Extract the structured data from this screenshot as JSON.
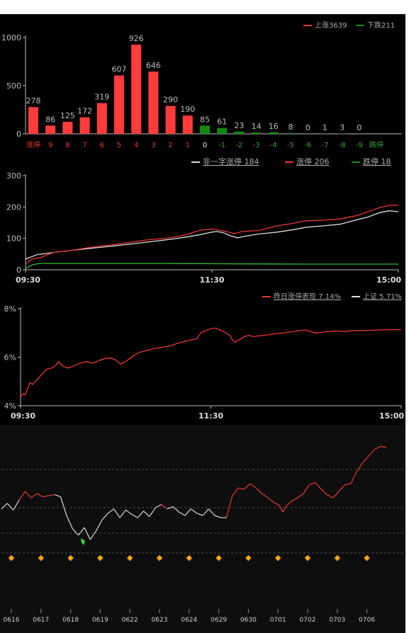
{
  "colors": {
    "red": "#e8382f",
    "bar_red": "#ff3b3b",
    "green": "#138a13",
    "white": "#dddddd",
    "axis": "#bbbbbb",
    "diamond": "#f5a70e",
    "highlight": "#3cdc3c"
  },
  "chart_data": [
    {
      "type": "bar",
      "legend": [
        {
          "name": "上涨3639",
          "color": "#e8382f"
        },
        {
          "name": "下跌211",
          "color": "#138a13"
        }
      ],
      "categories": [
        "涨停",
        "9",
        "8",
        "7",
        "6",
        "5",
        "4",
        "3",
        "2",
        "1",
        "0",
        "-1",
        "-2",
        "-3",
        "-4",
        "-5",
        "-6",
        "-7",
        "-8",
        "-9",
        "跌停"
      ],
      "values": [
        278,
        86,
        125,
        172,
        319,
        607,
        926,
        646,
        290,
        190,
        85,
        61,
        23,
        14,
        16,
        8,
        0,
        1,
        3,
        0
      ],
      "yticks": [
        "0",
        "500",
        "1000"
      ],
      "ylim": [
        0,
        1000
      ]
    },
    {
      "type": "line",
      "legend": [
        {
          "name": "非一字涨停 184",
          "color": "#dddddd"
        },
        {
          "name": "涨停 206",
          "color": "#e8382f"
        },
        {
          "name": "跌停 18",
          "color": "#138a13"
        }
      ],
      "xticks": [
        "09:30",
        "11:30",
        "15:00"
      ],
      "yticks": [
        "0",
        "100",
        "200",
        "300"
      ],
      "ylim": [
        0,
        300
      ],
      "series": [
        {
          "values": [
            [
              0,
              34
            ],
            [
              5,
              48
            ],
            [
              12,
              55
            ],
            [
              20,
              62
            ],
            [
              30,
              70
            ],
            [
              38,
              76
            ],
            [
              45,
              82
            ],
            [
              52,
              88
            ],
            [
              60,
              95
            ],
            [
              68,
              103
            ],
            [
              75,
              112
            ],
            [
              80,
              120
            ],
            [
              82,
              122
            ],
            [
              85,
              118
            ],
            [
              88,
              108
            ],
            [
              91,
              102
            ],
            [
              95,
              108
            ],
            [
              100,
              114
            ],
            [
              108,
              120
            ],
            [
              115,
              128
            ],
            [
              120,
              135
            ],
            [
              128,
              140
            ],
            [
              135,
              145
            ],
            [
              140,
              155
            ],
            [
              147,
              168
            ],
            [
              152,
              182
            ],
            [
              156,
              188
            ],
            [
              160,
              185
            ]
          ]
        },
        {
          "values": [
            [
              0,
              18
            ],
            [
              3,
              35
            ],
            [
              6,
              38
            ],
            [
              12,
              55
            ],
            [
              20,
              62
            ],
            [
              28,
              72
            ],
            [
              38,
              80
            ],
            [
              45,
              88
            ],
            [
              52,
              95
            ],
            [
              60,
              100
            ],
            [
              68,
              110
            ],
            [
              75,
              126
            ],
            [
              80,
              130
            ],
            [
              82,
              128
            ],
            [
              86,
              122
            ],
            [
              90,
              115
            ],
            [
              93,
              122
            ],
            [
              100,
              125
            ],
            [
              108,
              140
            ],
            [
              115,
              148
            ],
            [
              120,
              156
            ],
            [
              128,
              158
            ],
            [
              135,
              162
            ],
            [
              142,
              172
            ],
            [
              147,
              185
            ],
            [
              152,
              198
            ],
            [
              156,
              205
            ],
            [
              160,
              206
            ]
          ]
        },
        {
          "values": [
            [
              0,
              4
            ],
            [
              3,
              16
            ],
            [
              6,
              20
            ],
            [
              30,
              20
            ],
            [
              60,
              20
            ],
            [
              90,
              19
            ],
            [
              120,
              18
            ],
            [
              160,
              18
            ]
          ]
        }
      ]
    },
    {
      "type": "line",
      "legend": [
        {
          "name": "昨日涨停表现 7.14%",
          "color": "#e8382f"
        },
        {
          "name": "上证 5.71%",
          "color": "#dddddd"
        }
      ],
      "xticks": [
        "09:30",
        "11:30",
        "15:00"
      ],
      "yticks": [
        "4%",
        "6%",
        "8%"
      ],
      "ylim": [
        4,
        8
      ],
      "series": [
        {
          "values": [
            [
              0,
              4.35
            ],
            [
              1,
              4.5
            ],
            [
              2,
              4.45
            ],
            [
              3,
              4.72
            ],
            [
              4,
              4.95
            ],
            [
              5,
              4.88
            ],
            [
              7,
              5.08
            ],
            [
              9,
              5.3
            ],
            [
              11,
              5.5
            ],
            [
              13,
              5.55
            ],
            [
              15,
              5.68
            ],
            [
              16,
              5.82
            ],
            [
              17,
              5.7
            ],
            [
              18,
              5.62
            ],
            [
              20,
              5.55
            ],
            [
              22,
              5.62
            ],
            [
              24,
              5.72
            ],
            [
              26,
              5.78
            ],
            [
              28,
              5.82
            ],
            [
              30,
              5.75
            ],
            [
              32,
              5.82
            ],
            [
              34,
              5.9
            ],
            [
              36,
              5.95
            ],
            [
              38,
              5.97
            ],
            [
              40,
              5.88
            ],
            [
              42,
              5.72
            ],
            [
              44,
              5.82
            ],
            [
              46,
              5.95
            ],
            [
              48,
              6.1
            ],
            [
              50,
              6.2
            ],
            [
              52,
              6.25
            ],
            [
              54,
              6.3
            ],
            [
              56,
              6.35
            ],
            [
              58,
              6.38
            ],
            [
              60,
              6.42
            ],
            [
              62,
              6.45
            ],
            [
              64,
              6.5
            ],
            [
              66,
              6.58
            ],
            [
              68,
              6.62
            ],
            [
              70,
              6.68
            ],
            [
              72,
              6.72
            ],
            [
              74,
              6.75
            ],
            [
              75,
              6.9
            ],
            [
              76,
              7.02
            ],
            [
              78,
              7.1
            ],
            [
              80,
              7.18
            ],
            [
              82,
              7.2
            ],
            [
              84,
              7.12
            ],
            [
              86,
              7.02
            ],
            [
              88,
              6.9
            ],
            [
              89,
              6.72
            ],
            [
              90,
              6.62
            ],
            [
              92,
              6.72
            ],
            [
              94,
              6.85
            ],
            [
              96,
              6.9
            ],
            [
              98,
              6.85
            ],
            [
              100,
              6.88
            ],
            [
              104,
              6.92
            ],
            [
              108,
              6.98
            ],
            [
              112,
              7.02
            ],
            [
              116,
              7.08
            ],
            [
              120,
              7.12
            ],
            [
              122,
              7.05
            ],
            [
              124,
              7.0
            ],
            [
              126,
              7.02
            ],
            [
              128,
              7.05
            ],
            [
              132,
              7.08
            ],
            [
              136,
              7.06
            ],
            [
              140,
              7.1
            ],
            [
              145,
              7.1
            ],
            [
              150,
              7.12
            ],
            [
              155,
              7.14
            ],
            [
              160,
              7.14
            ]
          ]
        }
      ]
    },
    {
      "type": "line",
      "xticks": [
        "0616",
        "0617",
        "0618",
        "0619",
        "0622",
        "0623",
        "0624",
        "0629",
        "0630",
        "0701",
        "0702",
        "0703",
        "0706"
      ],
      "series": [
        {
          "values": [
            [
              0,
              4.6
            ],
            [
              2,
              5.1
            ],
            [
              4,
              4.5
            ],
            [
              6,
              5.4
            ],
            [
              8,
              6.2
            ],
            [
              10,
              5.6
            ],
            [
              12,
              6.0
            ],
            [
              14,
              5.7
            ],
            [
              16,
              5.8
            ],
            [
              18,
              5.9
            ],
            [
              20,
              5.7
            ],
            [
              22,
              4.0
            ],
            [
              24,
              2.8
            ],
            [
              26,
              2.2
            ],
            [
              28,
              2.9
            ],
            [
              30,
              1.8
            ],
            [
              32,
              2.6
            ],
            [
              34,
              3.6
            ],
            [
              36,
              4.2
            ],
            [
              38,
              4.6
            ],
            [
              40,
              3.8
            ],
            [
              42,
              4.5
            ],
            [
              44,
              4.1
            ],
            [
              46,
              3.8
            ],
            [
              48,
              4.4
            ],
            [
              50,
              3.9
            ],
            [
              52,
              4.7
            ],
            [
              54,
              5.0
            ],
            [
              56,
              4.6
            ],
            [
              58,
              4.8
            ],
            [
              60,
              4.3
            ],
            [
              62,
              4.0
            ],
            [
              64,
              4.6
            ],
            [
              66,
              4.2
            ],
            [
              68,
              4.0
            ],
            [
              70,
              4.6
            ],
            [
              72,
              4.0
            ],
            [
              74,
              3.8
            ],
            [
              76,
              3.8
            ],
            [
              78,
              5.8
            ],
            [
              80,
              6.5
            ],
            [
              82,
              6.4
            ],
            [
              84,
              6.9
            ],
            [
              86,
              6.5
            ],
            [
              88,
              6.0
            ],
            [
              90,
              5.6
            ],
            [
              92,
              5.2
            ],
            [
              94,
              4.9
            ],
            [
              95,
              4.3
            ],
            [
              96,
              4.8
            ],
            [
              98,
              5.3
            ],
            [
              100,
              5.6
            ],
            [
              102,
              6.0
            ],
            [
              104,
              6.8
            ],
            [
              106,
              7.0
            ],
            [
              108,
              6.4
            ],
            [
              110,
              5.9
            ],
            [
              112,
              5.6
            ],
            [
              114,
              6.2
            ],
            [
              116,
              6.8
            ],
            [
              118,
              6.9
            ],
            [
              120,
              8.0
            ],
            [
              122,
              8.8
            ],
            [
              124,
              9.4
            ],
            [
              126,
              10.0
            ],
            [
              128,
              10.3
            ],
            [
              130,
              10.2
            ]
          ]
        }
      ],
      "markers": [
        "◆",
        "◆",
        "◆",
        "◆",
        "◆",
        "◆",
        "◆",
        "◆",
        "◆",
        "◆",
        "◆",
        "◆",
        "◆"
      ]
    }
  ]
}
